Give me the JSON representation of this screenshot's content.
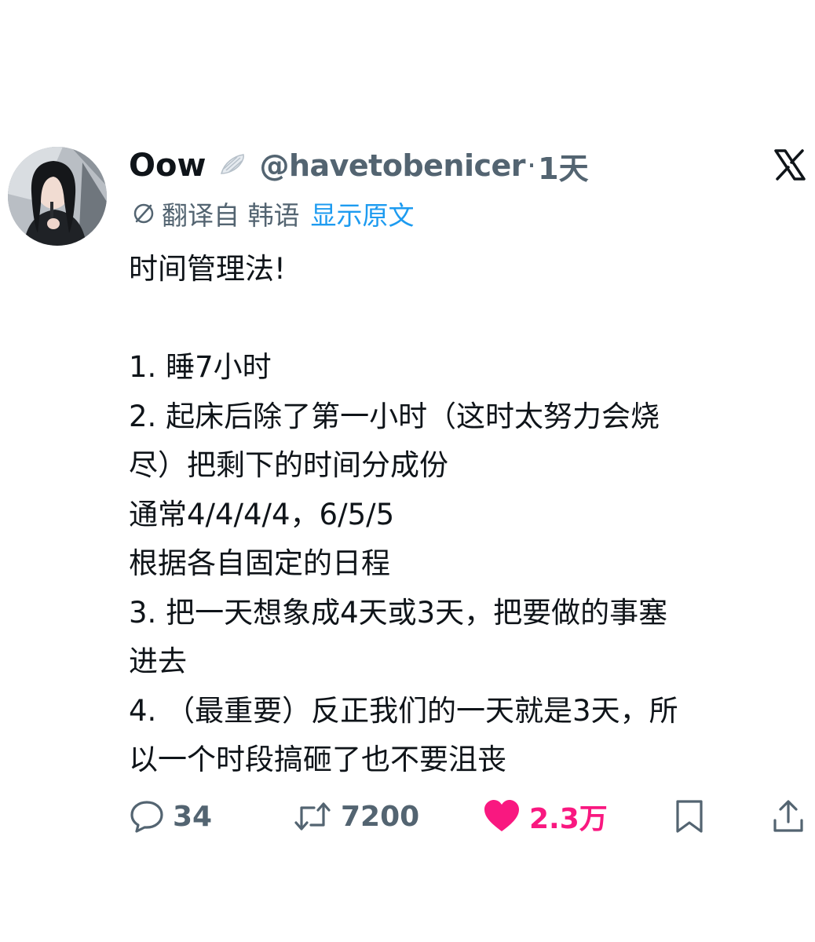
{
  "tweet": {
    "display_name": "Oow",
    "badge_icon": "angel-wing-emoji",
    "handle": "@havetobenicer",
    "separator": "·",
    "time": "1天",
    "close_icon": "x-logo-icon",
    "translation": {
      "icon": "translate-icon",
      "translated_from": "翻译自 韩语",
      "show_original": "显示原文"
    },
    "body_lines": [
      "时间管理法!",
      "",
      "1. 睡7小时",
      "2. 起床后除了第一小时（这时太努力会烧",
      "尽）把剩下的时间分成份",
      "通常4/4/4/4，6/5/5",
      "根据各自固定的日程",
      "3. 把一天想象成4天或3天，把要做的事塞",
      "进去",
      "4. （最重要）反正我们的一天就是3天，所",
      "以一个时段搞砸了也不要沮丧"
    ],
    "actions": {
      "reply_count": "34",
      "repost_count": "7200",
      "like_count": "2.3万",
      "like_color": "#f91880",
      "muted_color": "#536471",
      "link_color": "#1d9bf0"
    }
  }
}
